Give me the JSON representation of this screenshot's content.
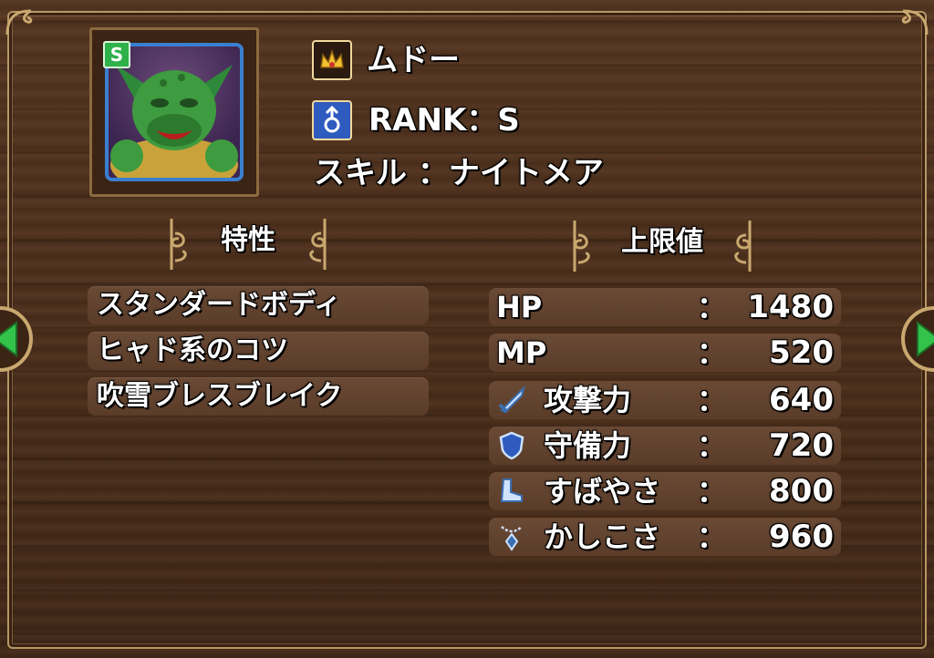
{
  "monster": {
    "name": "ムドー",
    "rank_line": "RANK：S",
    "skill_line": "スキル ：ナイトメア",
    "rank_badge": "S",
    "icons": {
      "name": "crown-icon",
      "rank": "male-symbol-icon"
    }
  },
  "traits": {
    "header": "特性",
    "items": [
      "スタンダードボディ",
      "ヒャド系のコツ",
      "吹雪ブレスブレイク"
    ]
  },
  "stats": {
    "header": "上限値",
    "colon": "：",
    "rows": [
      {
        "name": "HP",
        "value": "1480",
        "icon": ""
      },
      {
        "name": "MP",
        "value": "520",
        "icon": ""
      },
      {
        "name": "攻撃力",
        "value": "640",
        "icon": "sword-icon"
      },
      {
        "name": "守備力",
        "value": "720",
        "icon": "shield-icon"
      },
      {
        "name": "すばやさ",
        "value": "800",
        "icon": "boot-icon"
      },
      {
        "name": "かしこさ",
        "value": "960",
        "icon": "pendant-icon"
      }
    ]
  },
  "colors": {
    "accent_gold": "#f1d89b",
    "frame_gold": "#b79766",
    "arrow_green": "#33c24a",
    "rank_blue": "#2f5bbf"
  }
}
